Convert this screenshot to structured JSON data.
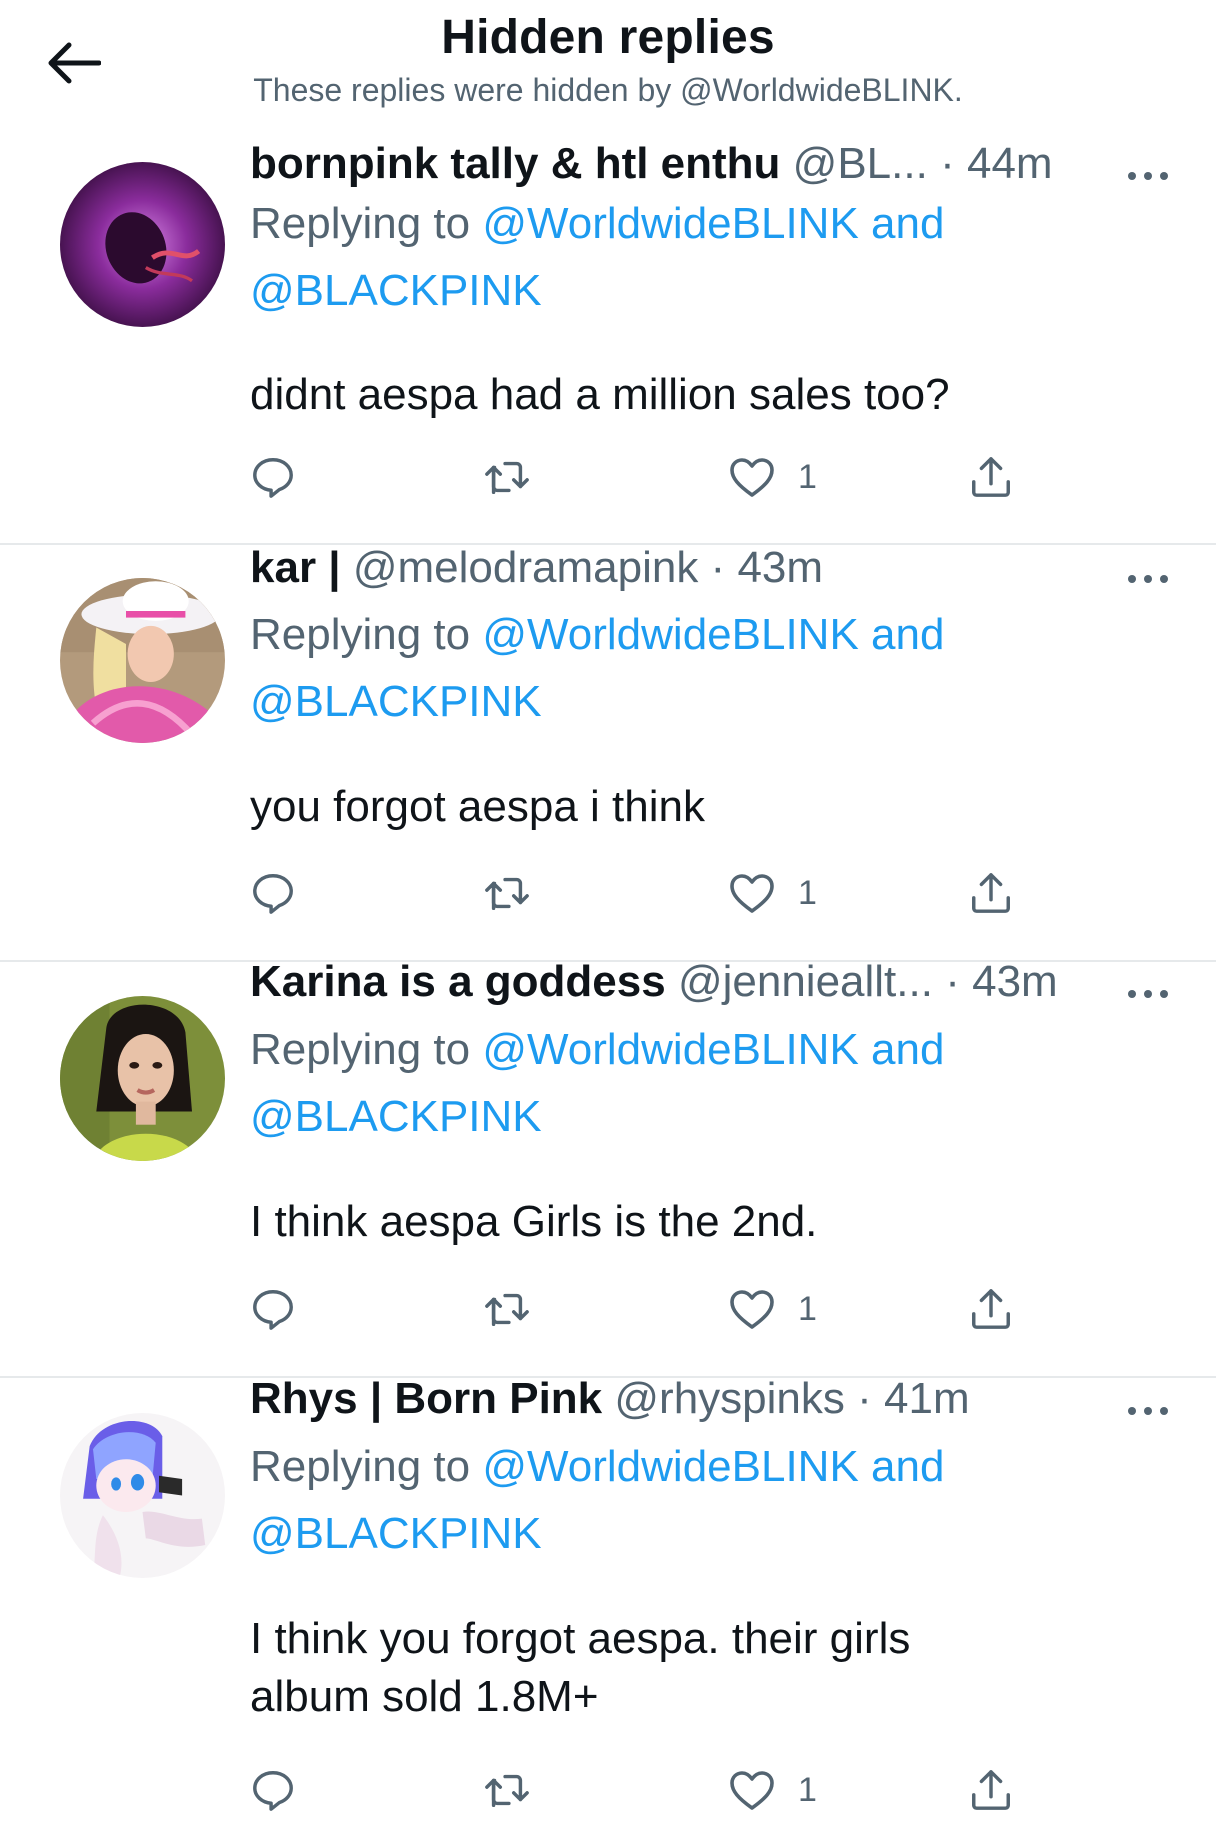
{
  "header": {
    "title": "Hidden replies",
    "subtitle": "These replies were hidden by @WorldwideBLINK."
  },
  "icons": {
    "back": "arrow-left-icon",
    "more": "more-horizontal-icon",
    "reply": "reply-bubble-icon",
    "retweet": "retweet-icon",
    "like": "heart-icon",
    "share": "share-icon"
  },
  "colors": {
    "link": "#1d9bf0",
    "secondary_text": "#536471",
    "primary_text": "#0f1419",
    "divider": "#e6e9eb"
  },
  "tweets": [
    {
      "display_name": "bornpink tally & htl enthu",
      "handle": "@BL...",
      "time": "44m",
      "replying_prefix": "Replying to",
      "mention_1": "@WorldwideBLINK",
      "and_word": "and",
      "mention_2": "@BLACKPINK",
      "text": "didnt aespa had a million sales too?",
      "likes": "1"
    },
    {
      "display_name": "kar |",
      "handle": "@melodramapink",
      "time": "43m",
      "replying_prefix": "Replying to",
      "mention_1": "@WorldwideBLINK",
      "and_word": "and",
      "mention_2": "@BLACKPINK",
      "text": "you forgot aespa i think",
      "likes": "1"
    },
    {
      "display_name": "Karina is a goddess",
      "handle": "@jennieallt...",
      "time": "43m",
      "replying_prefix": "Replying to",
      "mention_1": "@WorldwideBLINK",
      "and_word": "and",
      "mention_2": "@BLACKPINK",
      "text": "I think aespa Girls is the 2nd.",
      "likes": "1"
    },
    {
      "display_name": "Rhys | Born Pink",
      "handle": "@rhyspinks",
      "time": "41m",
      "replying_prefix": "Replying to",
      "mention_1": "@WorldwideBLINK",
      "and_word": "and",
      "mention_2": "@BLACKPINK",
      "text": "I think you forgot aespa. their girls album sold 1.8M+",
      "likes": "1"
    }
  ]
}
